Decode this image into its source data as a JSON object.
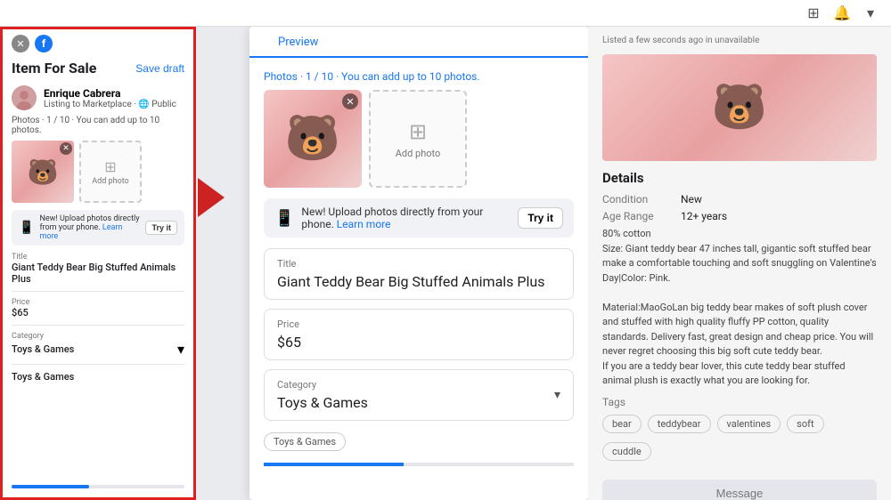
{
  "topbar": {
    "icons": [
      "grid-icon",
      "bell-icon",
      "chevron-icon"
    ]
  },
  "leftPanel": {
    "title": "Item For Sale",
    "saveDraft": "Save draft",
    "user": {
      "name": "Enrique Cabrera",
      "listing": "Listing to Marketplace · 🌐 Public"
    },
    "photosLabel": "Photos · 1 / 10 · You can add up to 10 photos.",
    "addPhotoLabel": "Add photo",
    "uploadBanner": {
      "text": "New! Upload photos directly from your phone.",
      "learnMore": "Learn more",
      "tryIt": "Try it"
    },
    "fields": {
      "title": {
        "label": "Title",
        "value": "Giant Teddy Bear Big Stuffed Animals Plus"
      },
      "price": {
        "label": "Price",
        "value": "$65"
      },
      "category": {
        "label": "Category",
        "value": "Toys & Games"
      },
      "categoryTag": "Toys & Games"
    }
  },
  "previewPanel": {
    "tabLabel": "Preview",
    "photosHeader": "Photos · 1 / 10 · You can add up to 10 photos.",
    "addPhotoLabel": "Add photo",
    "uploadBanner": {
      "text": "New! Upload photos directly from your phone.",
      "learnMore": "Learn more",
      "tryIt": "Try it"
    },
    "titleCard": {
      "label": "Title",
      "value": "Giant Teddy Bear Big Stuffed Animals Plus"
    },
    "priceCard": {
      "label": "Price",
      "value": "$65"
    },
    "categoryCard": {
      "label": "Category",
      "value": "Toys & Games"
    },
    "categoryTag": "Toys & Games",
    "progressPct": 45
  },
  "rightPanel": {
    "introText": "Listed a few seconds ago in unavailable",
    "detailsTitle": "Details",
    "details": [
      {
        "key": "Condition",
        "value": "New"
      },
      {
        "key": "Age Range",
        "value": "12+ years"
      }
    ],
    "descLines": [
      "80% cotton",
      "Size: Giant teddy bear 47 inches tall, gigantic soft stuffed bear make a comfortable touching and soft snuggling on Valentine's Day|Color: Pink.",
      "",
      "Material:MaoGoLan big teddy bear makes of soft plush cover and stuffed with high quality fluffy PP cotton, quality standards. Delivery fast, great design and cheap price. You will never regret choosing this big soft cute teddy bear.",
      "If you are a teddy bear lover, this cute teddy bear stuffed animal plush is exactly what you are looking for."
    ],
    "tagsTitle": "Tags",
    "tags": [
      "bear",
      "teddybear",
      "valentines",
      "soft",
      "cuddle"
    ],
    "messageBtn": "Message"
  }
}
